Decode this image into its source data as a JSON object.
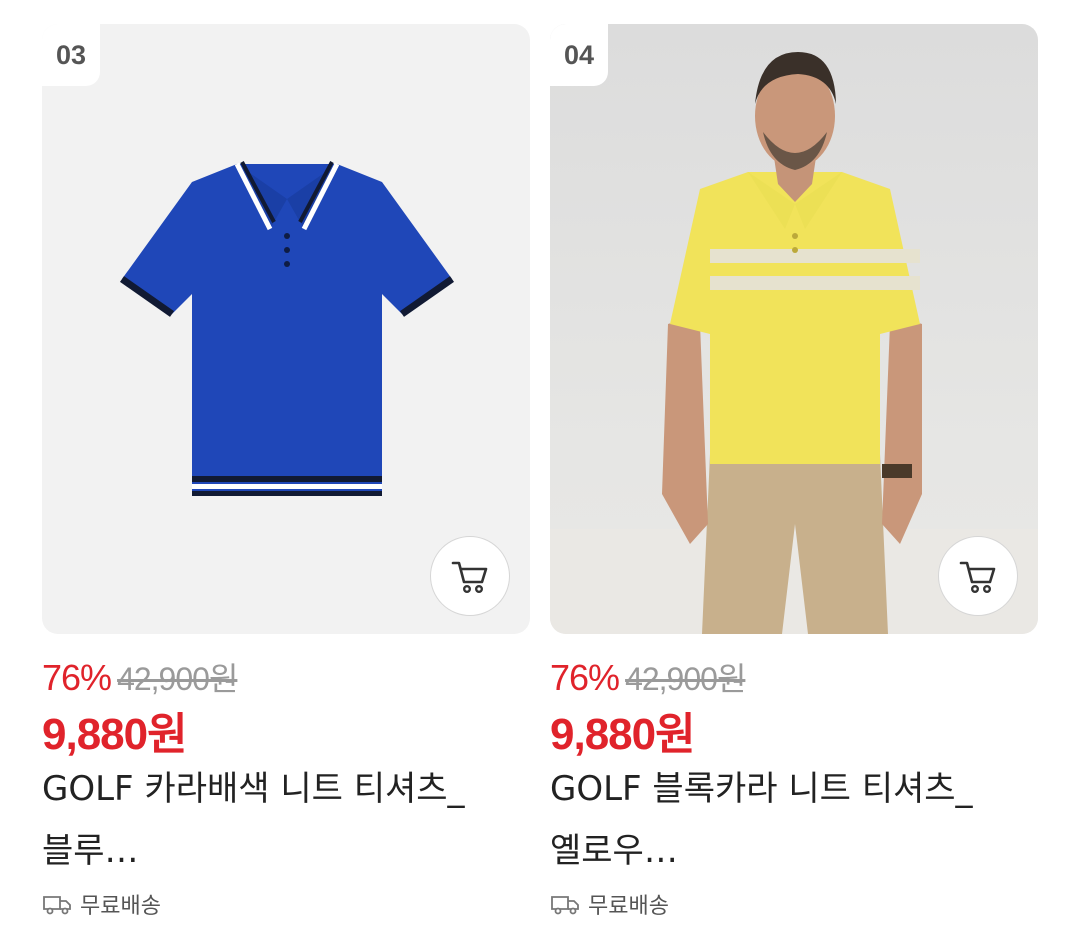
{
  "products": [
    {
      "rank": "03",
      "discount": "76%",
      "original_price": "42,900원",
      "sale_price": "9,880원",
      "name": "GOLF 카라배색 니트 티셔츠_블루…",
      "shipping": "무료배송",
      "image_icon": "blue-polo-shirt-image",
      "colors": {
        "shirt": "#1f47b8",
        "trim_dark": "#111a33",
        "trim_light": "#ffffff"
      }
    },
    {
      "rank": "04",
      "discount": "76%",
      "original_price": "42,900원",
      "sale_price": "9,880원",
      "name": "GOLF 블록카라 니트 티셔츠_옐로우…",
      "shipping": "무료배송",
      "image_icon": "yellow-polo-model-image",
      "colors": {
        "shirt": "#f1e35a",
        "stripe": "#e6e2cf",
        "pants": "#c8b08c"
      }
    }
  ],
  "accent_color": "#e0232b",
  "icons": {
    "cart": "cart-icon",
    "truck": "truck-icon"
  }
}
